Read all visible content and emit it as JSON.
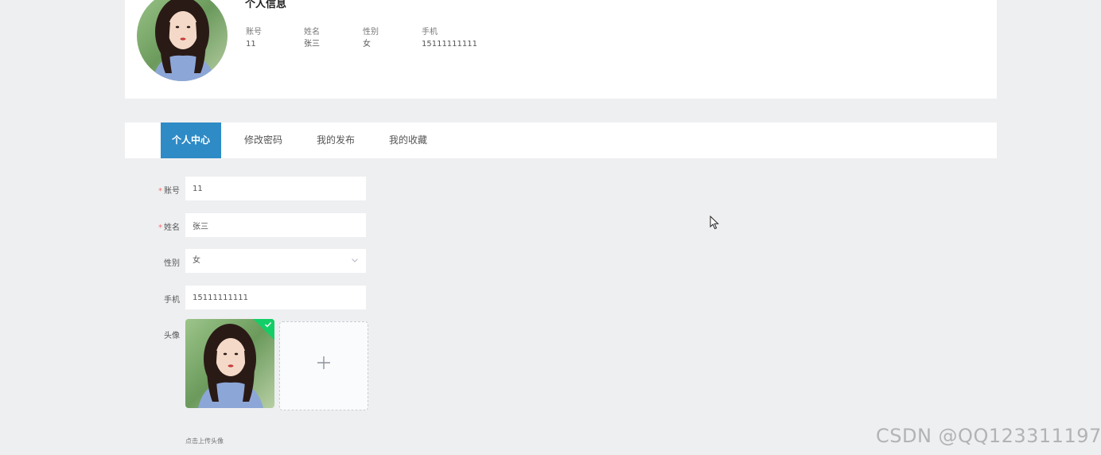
{
  "profile": {
    "title": "个人信息",
    "fields": [
      {
        "label": "账号",
        "value": "11"
      },
      {
        "label": "姓名",
        "value": "张三"
      },
      {
        "label": "性别",
        "value": "女"
      },
      {
        "label": "手机",
        "value": "15111111111"
      }
    ]
  },
  "tabs": [
    {
      "label": "个人中心",
      "active": true
    },
    {
      "label": "修改密码",
      "active": false
    },
    {
      "label": "我的发布",
      "active": false
    },
    {
      "label": "我的收藏",
      "active": false
    }
  ],
  "form": {
    "account": {
      "label": "账号",
      "required": true,
      "value": "11"
    },
    "name": {
      "label": "姓名",
      "required": true,
      "value": "张三"
    },
    "gender": {
      "label": "性别",
      "value": "女"
    },
    "phone": {
      "label": "手机",
      "value": "15111111111"
    },
    "avatar": {
      "label": "头像",
      "hint": "点击上传头像"
    }
  },
  "icons": {
    "add": "plus-icon",
    "select": "chevron-down-icon",
    "upload_done": "check-icon"
  },
  "colors": {
    "accent": "#2e8bc6",
    "required": "#f56c6c",
    "success": "#13ce66",
    "background": "#eeeff1"
  },
  "watermark": "CSDN @QQ123311197"
}
